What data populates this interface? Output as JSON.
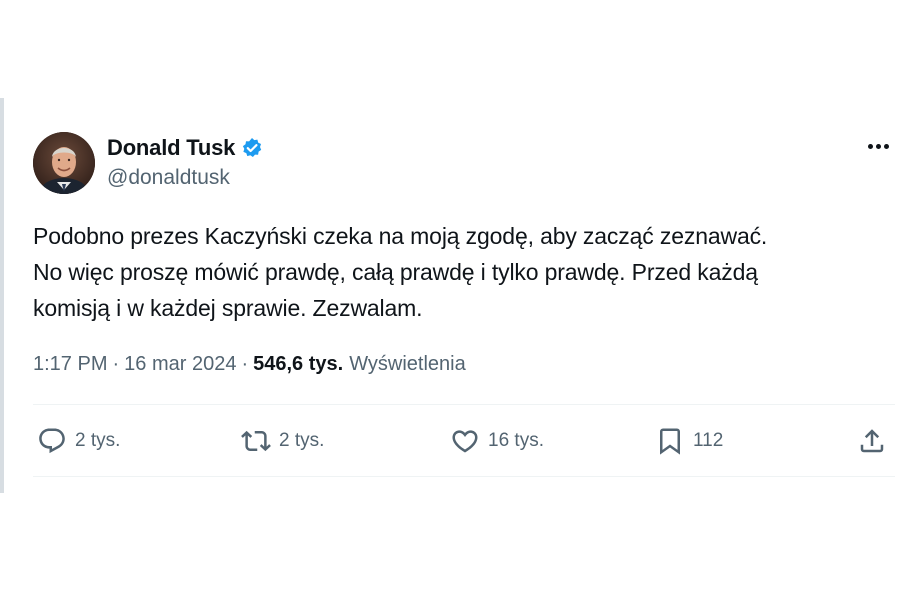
{
  "author": {
    "display_name": "Donald Tusk",
    "handle": "@donaldtusk",
    "verified": true
  },
  "tweet": {
    "lines": [
      "Podobno prezes Kaczyński czeka na moją zgodę, aby zacząć zeznawać.",
      "No więc proszę mówić prawdę, całą prawdę i tylko prawdę. Przed każdą",
      "komisją i w każdej sprawie. Zezwalam."
    ]
  },
  "meta": {
    "time": "1:17 PM",
    "separator": "·",
    "date": "16 mar 2024",
    "views_count": "546,6 tys.",
    "views_label": "Wyświetlenia"
  },
  "actions": {
    "replies": "2 tys.",
    "reposts": "2 tys.",
    "likes": "16 tys.",
    "bookmarks": "112"
  },
  "colors": {
    "text": "#0f1419",
    "secondary": "#536471",
    "verified": "#1d9bf0",
    "divider": "#eff3f4"
  },
  "icons": [
    "verified-badge-icon",
    "more-icon",
    "reply-icon",
    "retweet-icon",
    "like-icon",
    "bookmark-icon",
    "share-icon"
  ]
}
